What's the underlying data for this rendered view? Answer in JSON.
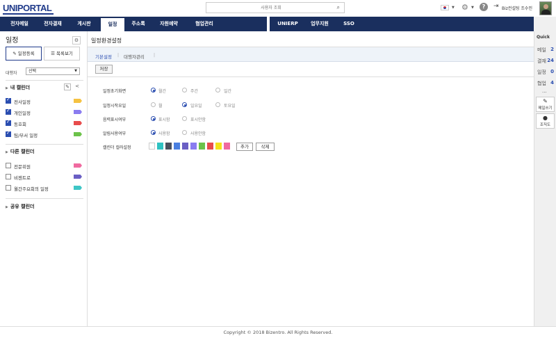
{
  "header": {
    "logo": "UNIPORTAL",
    "search_placeholder": "사용자 조회",
    "user_name": "Biz컨설팅 조수민"
  },
  "nav": {
    "items": [
      "전자메일",
      "전자결재",
      "게시판",
      "일정",
      "주소록",
      "자원예약",
      "협업관리"
    ],
    "active": "일정",
    "right_items": [
      "UNIERP",
      "업무지원",
      "SSO"
    ]
  },
  "quick": {
    "title": "Quick",
    "items": [
      {
        "label": "메일",
        "count": "2"
      },
      {
        "label": "결재",
        "count": "24"
      },
      {
        "label": "일정",
        "count": "0"
      },
      {
        "label": "협업",
        "count": "4"
      }
    ],
    "more": "...",
    "write_mail": "메일쓰기",
    "org_chart": "조직도"
  },
  "sidebar": {
    "title": "일정",
    "register_btn": "일정등록",
    "list_btn": "목록보기",
    "target_label": "대행자",
    "target_value": "선택",
    "my_calendar": {
      "title": "내 캘린더",
      "items": [
        {
          "label": "전사일정",
          "checked": true,
          "color": "#f5c242"
        },
        {
          "label": "개인일정",
          "checked": true,
          "color": "#8a7cf0"
        },
        {
          "label": "동호회",
          "checked": true,
          "color": "#e84c4c"
        },
        {
          "label": "팀/부서 일정",
          "checked": true,
          "color": "#6cc24a"
        }
      ]
    },
    "other_calendar": {
      "title": "다른 캘린더",
      "items": [
        {
          "label": "전문위원",
          "checked": false,
          "color": "#f06aa0"
        },
        {
          "label": "비젠트로",
          "checked": false,
          "color": "#6a5fc4"
        },
        {
          "label": "월간주요회의 일정",
          "checked": false,
          "color": "#3ec6c6"
        }
      ]
    },
    "shared_calendar": {
      "title": "공유 캘린더"
    }
  },
  "main": {
    "title": "일정환경설정",
    "tabs": [
      "기본설정",
      "대행자관리"
    ],
    "active_tab": "기본설정",
    "save_btn": "저장",
    "rows": [
      {
        "label": "일정초기화면",
        "options": [
          "월간",
          "주간",
          "일간"
        ],
        "selected": 0
      },
      {
        "label": "일정시작요일",
        "options": [
          "월",
          "일요일",
          "토요일"
        ],
        "selected": 1
      },
      {
        "label": "음력표시여부",
        "options": [
          "표시함",
          "표시안함"
        ],
        "selected": 0
      },
      {
        "label": "알림사용여부",
        "options": [
          "사용함",
          "사용안함"
        ],
        "selected": 0
      }
    ],
    "color_label": "캘린더 컬러설정",
    "colors": [
      "#ffffff",
      "#2fc2c2",
      "#4a4f5c",
      "#4a7fe0",
      "#6a5fc4",
      "#8a7cf0",
      "#6cc24a",
      "#e84c4c",
      "#f5e21a",
      "#f06aa0"
    ],
    "add_btn": "추가",
    "delete_btn": "삭제"
  },
  "footer": {
    "copyright": "Copyright © 2018 Bizentro. All Rights Reserved."
  }
}
